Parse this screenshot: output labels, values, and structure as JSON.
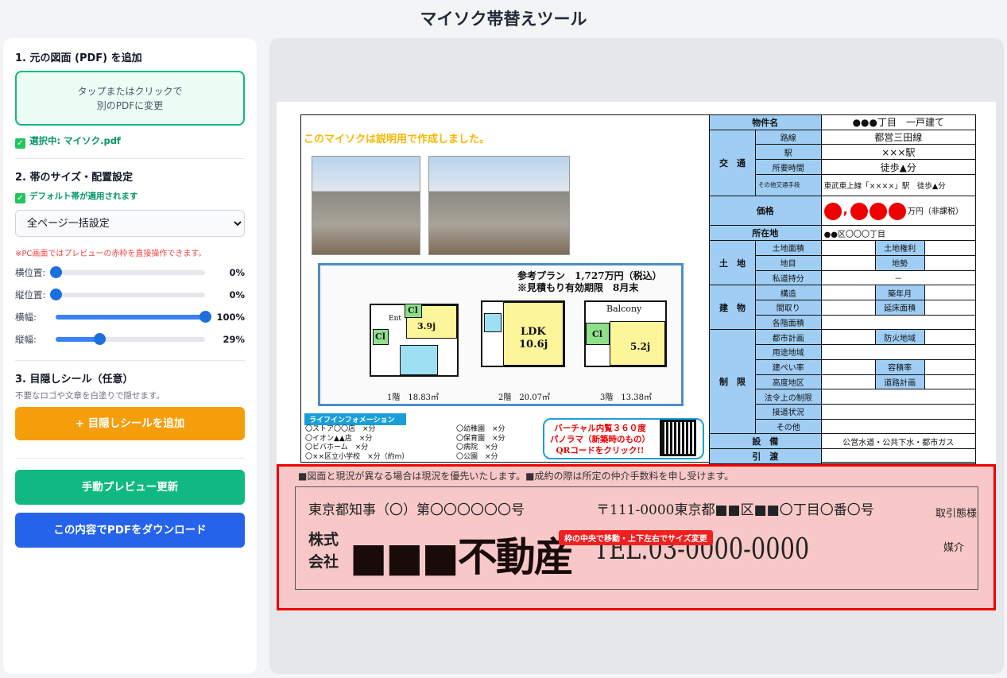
{
  "app": {
    "title": "マイソク帯替えツール"
  },
  "step1": {
    "heading": "1. 元の図面 (PDF) を追加",
    "drop_line1": "タップまたはクリックで",
    "drop_line2": "別のPDFに変更",
    "selected": "選択中: マイソク.pdf"
  },
  "step2": {
    "heading": "2. 帯のサイズ・配置設定",
    "default_note": "デフォルト帯が適用されます",
    "select_value": "全ページ一括設定",
    "pc_note": "※PC画面ではプレビューの赤枠を直接操作できます。",
    "sliders": [
      {
        "label": "横位置:",
        "value": 0,
        "display": "0%"
      },
      {
        "label": "縦位置:",
        "value": 0,
        "display": "0%"
      },
      {
        "label": "横幅:",
        "value": 100,
        "display": "100%"
      },
      {
        "label": "縦幅:",
        "value": 29,
        "display": "29%"
      }
    ]
  },
  "step3": {
    "heading": "3. 目隠しシール（任意）",
    "desc": "不要なロゴや文章を白塗りで隠せます。",
    "add_button": "+ 目隠しシールを追加"
  },
  "actions": {
    "refresh": "手動プレビュー更新",
    "download": "この内容でPDFをダウンロード"
  },
  "colors": {
    "green": "#10b981",
    "orange": "#f59e0b",
    "blue": "#2563eb",
    "band_border": "#ee0000"
  },
  "doc": {
    "notice": "このマイソクは説明用で作成しました。",
    "plan_title": "参考プラン　1,727万円（税込）",
    "plan_sub": "※見積もり有効期限　8月末",
    "floor1": "1階　18.83㎡",
    "floor2": "2階　20.07㎡",
    "floor3": "3階　13.38㎡",
    "room1": "3.9j",
    "room2": "LDK",
    "room2b": "10.6j",
    "room3": "5.2j",
    "balcony": "Balcony",
    "cl1": "Cl",
    "cl2": "Cl",
    "cl3": "Cl",
    "ent": "Ent",
    "life_title": "ライフインフォメーション",
    "life_left": [
      "〇ストア〇〇店　×分",
      "〇イオン▲▲店　×分",
      "〇ビバホーム　×分",
      "〇××区立小学校　×分（約m）"
    ],
    "life_right": [
      "〇幼稚園　×分",
      "〇保育園　×分",
      "〇病院　×分",
      "〇公園　×分"
    ],
    "vr_lines": [
      "バーチャル内覧３６０度",
      "パノラマ（新築時のもの）",
      "QRコードをクリック!!"
    ],
    "table": {
      "name_l": "物件名",
      "name_v": "●●●丁目　一戸建て",
      "kotsu": "交　通",
      "route_l": "路線",
      "route_v": "都営三田線",
      "station_l": "駅",
      "station_v": "×××駅",
      "time_l": "所要時間",
      "time_v": "徒歩▲分",
      "other_l": "その他交通手段",
      "other_v": "東武東上線「××××」駅　徒歩▲分",
      "price_l": "価格",
      "price_unit": "万円（非課税）",
      "addr_l": "所在地",
      "addr_v": "●●区〇〇〇丁目",
      "land": "土　地",
      "land_area": "土地面積",
      "land_right": "土地権利",
      "land_cat": "地目",
      "land_shape": "地勢",
      "private": "私道持分",
      "private_v": "－",
      "bldg": "建　物",
      "structure": "構造",
      "built": "築年月",
      "layout": "間取り",
      "floor_area": "延床面積",
      "each_floor": "各階面積",
      "restrict": "制　限",
      "city_plan": "都市計画",
      "fire": "防火地域",
      "zoning": "用途地域",
      "bcr": "建ぺい率",
      "far": "容積率",
      "height": "高度地区",
      "road_plan": "道路計画",
      "law": "法令上の制限",
      "road": "接道状況",
      "other": "その他",
      "equip": "設　備",
      "equip_v": "公営水道・公共下水・都市ガス",
      "deliver": "引　渡"
    }
  },
  "band": {
    "top": "■図面と現況が異なる場合は現況を優先いたします。■成約の際は所定の仲介手数料を申し受けます。",
    "license": "東京都知事（〇）第〇〇〇〇〇〇号",
    "address": "〒111-0000東京都■■区■■〇丁目〇番〇号",
    "kabu": "株式",
    "kaisha": "会社",
    "company": "■■■不動産",
    "tel": "TEL.03-0000-0000",
    "deal_type": "取引態様",
    "deal_value": "媒介",
    "hint": "枠の中央で移動・上下左右でサイズ変更"
  }
}
